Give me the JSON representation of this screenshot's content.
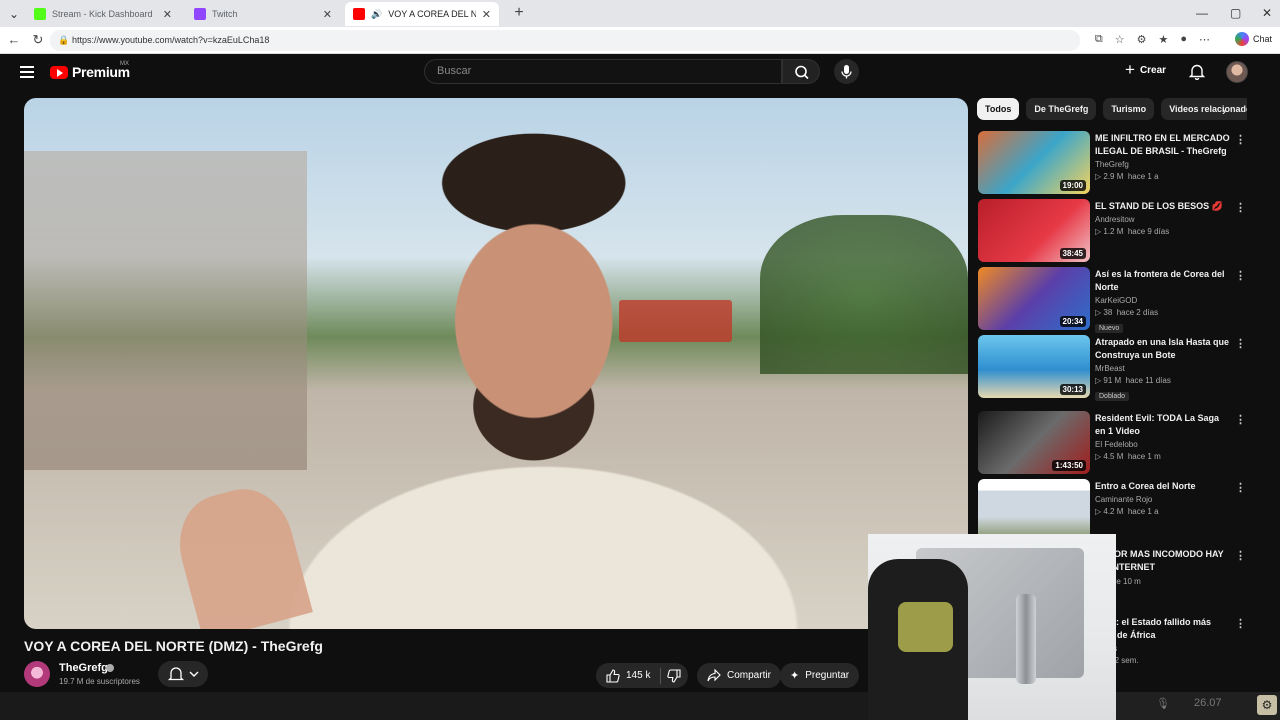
{
  "browser": {
    "tabs": [
      {
        "title": "Stream - Kick Dashboard",
        "favicon_color": "#53fc18",
        "active": false
      },
      {
        "title": "Twitch",
        "favicon_color": "#9146ff",
        "active": false
      },
      {
        "title": "VOY A COREA DEL NORTE (DMZ",
        "favicon_color": "#ff0000",
        "active": true
      }
    ],
    "url": "https://www.youtube.com/watch?v=kzaEuLCha18",
    "chat_label": "Chat",
    "icons": [
      "tab-menu-icon",
      "back-icon",
      "reload-icon",
      "lock-icon",
      "favorites-icon",
      "extensions-icon",
      "profile-icon",
      "more-icon",
      "copilot-icon"
    ]
  },
  "youtube": {
    "brand": "Premium",
    "country": "MX",
    "search_placeholder": "Buscar",
    "create_label": "Crear"
  },
  "video": {
    "title": "VOY A COREA DEL NORTE (DMZ) - TheGrefg",
    "channel": "TheGrefg",
    "subscribers": "19.7 M de suscriptores",
    "likes": "145 k",
    "share_label": "Compartir",
    "ask_label": "Preguntar"
  },
  "chips": [
    "Todos",
    "De TheGrefg",
    "Turismo",
    "Videos relacionados"
  ],
  "recommendations": [
    {
      "title": "ME INFILTRO EN EL MERCADO ILEGAL DE BRASIL - TheGrefg",
      "channel": "TheGrefg",
      "views": "2.9 M",
      "age": "hace 1 a",
      "duration": "19:00",
      "badge": ""
    },
    {
      "title": "EL STAND DE LOS BESOS 💋",
      "channel": "Andresitow",
      "views": "1.2 M",
      "age": "hace 9 días",
      "duration": "38:45",
      "badge": ""
    },
    {
      "title": "Así es la frontera de Corea del Norte",
      "channel": "KarKeiGOD",
      "views": "38",
      "age": "hace 2 días",
      "duration": "20:34",
      "badge": "Nuevo"
    },
    {
      "title": "Atrapado en una Isla Hasta que Construya un Bote",
      "channel": "MrBeast",
      "views": "91 M",
      "age": "hace 11 días",
      "duration": "30:13",
      "badge": "Doblado"
    },
    {
      "title": "Resident Evil: TODA La Saga en 1 Video",
      "channel": "El Fedelobo",
      "views": "4.5 M",
      "age": "hace 1 m",
      "duration": "1:43:50",
      "badge": ""
    },
    {
      "title": "Entro a Corea del Norte",
      "channel": "Caminante Rojo",
      "views": "4.2 M",
      "age": "hace 1 a",
      "duration": "",
      "badge": ""
    },
    {
      "title": "ERROR MAS INCOMODO HAY EN INTERNET",
      "channel": "",
      "views": "k",
      "age": "hace 10 m",
      "duration": "",
      "badge": ""
    },
    {
      "title": "ALIA: el Estado fallido más roso de África",
      "channel": "Crysis",
      "views": "",
      "age": "hace 2 sem.",
      "duration": "",
      "badge": ""
    }
  ],
  "overlay": {
    "time": "26.07"
  }
}
